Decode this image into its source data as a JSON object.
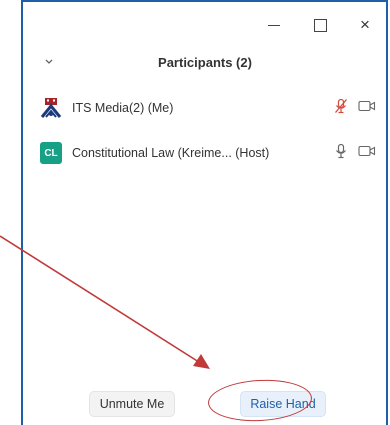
{
  "window": {
    "close_glyph": "×"
  },
  "panel": {
    "title": "Participants (2)"
  },
  "participants": [
    {
      "name": "ITS Media(2) (Me)",
      "avatar_icon": "university-logo-icon",
      "audio": "muted",
      "video": "off"
    },
    {
      "name": "Constitutional Law (Kreime... (Host)",
      "avatar_initials": "CL",
      "avatar_color": "#16a085",
      "audio": "unmuted",
      "video": "off"
    }
  ],
  "buttons": {
    "unmute_label": "Unmute Me",
    "raise_hand_label": "Raise Hand"
  },
  "colors": {
    "frame_border": "#1f5fa8",
    "muted_red": "#d24a3b",
    "annotation_red": "#c03a3a",
    "raise_text": "#1f5fa8"
  }
}
